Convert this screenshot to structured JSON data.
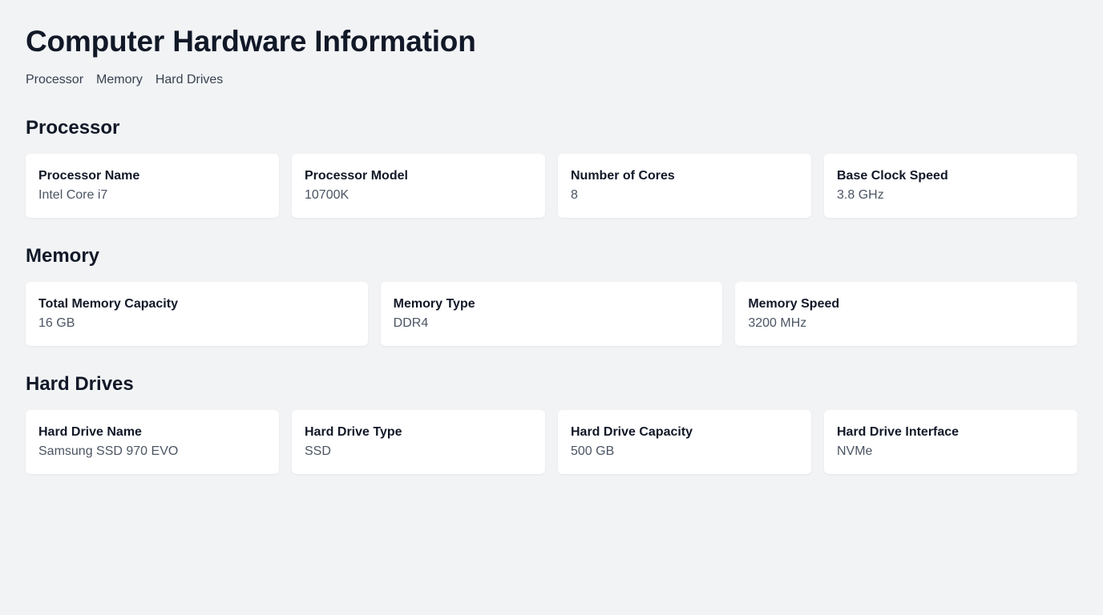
{
  "page": {
    "title": "Computer Hardware Information"
  },
  "nav": [
    {
      "label": "Processor"
    },
    {
      "label": "Memory"
    },
    {
      "label": "Hard Drives"
    }
  ],
  "sections": {
    "processor": {
      "title": "Processor",
      "cards": [
        {
          "label": "Processor Name",
          "value": "Intel Core i7"
        },
        {
          "label": "Processor Model",
          "value": "10700K"
        },
        {
          "label": "Number of Cores",
          "value": "8"
        },
        {
          "label": "Base Clock Speed",
          "value": "3.8 GHz"
        }
      ]
    },
    "memory": {
      "title": "Memory",
      "cards": [
        {
          "label": "Total Memory Capacity",
          "value": "16 GB"
        },
        {
          "label": "Memory Type",
          "value": "DDR4"
        },
        {
          "label": "Memory Speed",
          "value": "3200 MHz"
        }
      ]
    },
    "hard_drives": {
      "title": "Hard Drives",
      "cards": [
        {
          "label": "Hard Drive Name",
          "value": "Samsung SSD 970 EVO"
        },
        {
          "label": "Hard Drive Type",
          "value": "SSD"
        },
        {
          "label": "Hard Drive Capacity",
          "value": "500 GB"
        },
        {
          "label": "Hard Drive Interface",
          "value": "NVMe"
        }
      ]
    }
  },
  "colors": {
    "background": "#f2f3f5",
    "card": "#ffffff",
    "heading": "#111827",
    "muted_text": "#4b5563"
  }
}
